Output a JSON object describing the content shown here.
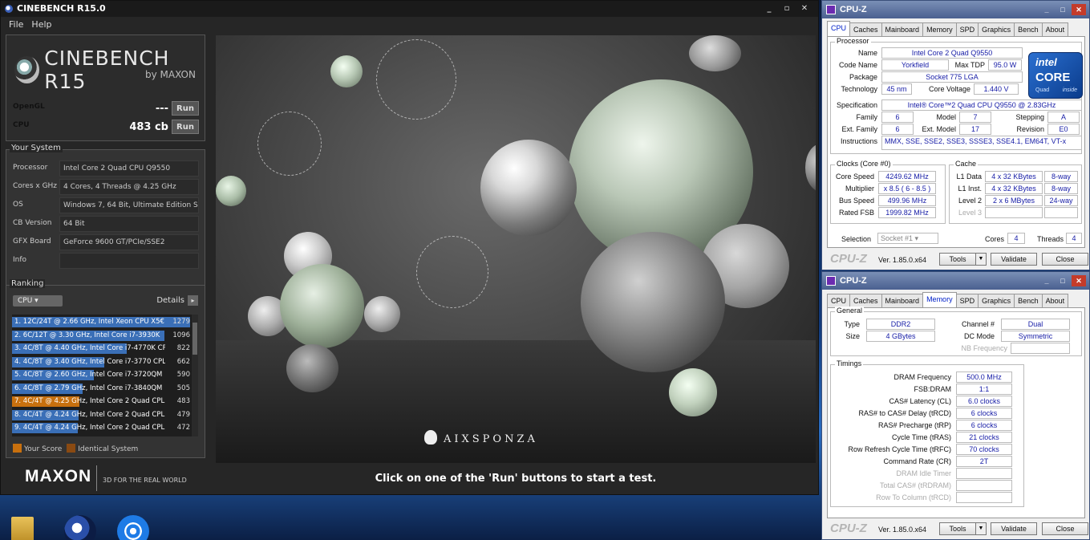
{
  "cinebench": {
    "title": "CINEBENCH R15.0",
    "menu": [
      "File",
      "Help"
    ],
    "brand": "CINEBENCH R15",
    "brand_sub": "by MAXON",
    "opengl_label": "OpenGL",
    "opengl_value": "---",
    "cpu_label": "CPU",
    "cpu_value": "483 cb",
    "run_label": "Run",
    "your_system_title": "Your System",
    "system": [
      {
        "key": "Processor",
        "value": "Intel Core 2 Quad CPU Q9550"
      },
      {
        "key": "Cores x GHz",
        "value": "4 Cores, 4 Threads @ 4.25 GHz"
      },
      {
        "key": "OS",
        "value": "Windows 7, 64 Bit, Ultimate Edition Ser"
      },
      {
        "key": "CB Version",
        "value": "64 Bit"
      },
      {
        "key": "GFX Board",
        "value": "GeForce 9600 GT/PCIe/SSE2"
      },
      {
        "key": "Info",
        "value": ""
      }
    ],
    "ranking_title": "Ranking",
    "ranking_select": "CPU",
    "details_label": "Details",
    "ranking_max": 1279,
    "ranking": [
      {
        "text": "1. 12C/24T @ 2.66 GHz, Intel Xeon CPU X5€",
        "score": "1279",
        "value": 1279,
        "color": "#3a6fb7"
      },
      {
        "text": "2. 6C/12T @ 3.30 GHz,  Intel Core i7-3930K",
        "score": "1096",
        "value": 1096,
        "color": "#3a6fb7"
      },
      {
        "text": "3. 4C/8T @ 4.40 GHz, Intel Core i7-4770K CP",
        "score": "822",
        "value": 822,
        "color": "#3a6fb7"
      },
      {
        "text": "4. 4C/8T @ 3.40 GHz,  Intel Core i7-3770 CPL",
        "score": "662",
        "value": 662,
        "color": "#3a6fb7"
      },
      {
        "text": "5. 4C/8T @ 2.60 GHz, Intel Core i7-3720QM",
        "score": "590",
        "value": 590,
        "color": "#3a6fb7"
      },
      {
        "text": "6. 4C/8T @ 2.79 GHz,  Intel Core i7-3840QM",
        "score": "505",
        "value": 505,
        "color": "#3a6fb7"
      },
      {
        "text": "7. 4C/4T @ 4.25 GHz, Intel Core 2 Quad CPL",
        "score": "483",
        "value": 483,
        "color": "#c8700e"
      },
      {
        "text": "8. 4C/4T @ 4.24 GHz, Intel Core 2 Quad CPL",
        "score": "479",
        "value": 479,
        "color": "#3a6fb7"
      },
      {
        "text": "9. 4C/4T @ 4.24 GHz, Intel Core 2 Quad CPL",
        "score": "472",
        "value": 472,
        "color": "#3a6fb7"
      }
    ],
    "legend_your_score": "Your Score",
    "legend_identical": "Identical System",
    "legend_your_color": "#c8700e",
    "legend_identical_color": "#8a4a12",
    "maxon_logo": "MAXON",
    "maxon_tag": "3D FOR THE REAL WORLD",
    "render_brand": "AIXSPONZA",
    "status": "Click on one of the 'Run' buttons to start a test."
  },
  "cpuz_cpu": {
    "title": "CPU-Z",
    "tabs": [
      "CPU",
      "Caches",
      "Mainboard",
      "Memory",
      "SPD",
      "Graphics",
      "Bench",
      "About"
    ],
    "processor_title": "Processor",
    "name_label": "Name",
    "name": "Intel Core 2 Quad Q9550",
    "codename_label": "Code Name",
    "codename": "Yorkfield",
    "maxtdp_label": "Max TDP",
    "maxtdp": "95.0 W",
    "package_label": "Package",
    "package": "Socket 775 LGA",
    "technology_label": "Technology",
    "technology": "45 nm",
    "corevoltage_label": "Core Voltage",
    "corevoltage": "1.440 V",
    "spec_label": "Specification",
    "spec": "Intel® Core™2 Quad CPU    Q9550  @ 2.83GHz",
    "family_label": "Family",
    "family": "6",
    "model_label": "Model",
    "model": "7",
    "stepping_label": "Stepping",
    "stepping": "A",
    "extfamily_label": "Ext. Family",
    "extfamily": "6",
    "extmodel_label": "Ext. Model",
    "extmodel": "17",
    "revision_label": "Revision",
    "revision": "E0",
    "instructions_label": "Instructions",
    "instructions": "MMX, SSE, SSE2, SSE3, SSSE3, SSE4.1, EM64T, VT-x",
    "clocks_title": "Clocks (Core #0)",
    "corespeed_label": "Core Speed",
    "corespeed": "4249.62 MHz",
    "multiplier_label": "Multiplier",
    "multiplier": "x 8.5 ( 6 - 8.5 )",
    "busspeed_label": "Bus Speed",
    "busspeed": "499.96 MHz",
    "ratedfsb_label": "Rated FSB",
    "ratedfsb": "1999.82 MHz",
    "cache_title": "Cache",
    "l1data_label": "L1 Data",
    "l1data": "4 x 32 KBytes",
    "l1data_way": "8-way",
    "l1inst_label": "L1 Inst.",
    "l1inst": "4 x 32 KBytes",
    "l1inst_way": "8-way",
    "level2_label": "Level 2",
    "level2": "2 x 6 MBytes",
    "level2_way": "24-way",
    "level3_label": "Level 3",
    "selection_label": "Selection",
    "selection": "Socket #1",
    "cores_label": "Cores",
    "cores": "4",
    "threads_label": "Threads",
    "threads": "4",
    "intel_brand": "intel",
    "intel_core": "CORE",
    "intel_quad": "Quad",
    "intel_inside": "inside",
    "logo": "CPU-Z",
    "version": "Ver. 1.85.0.x64",
    "tools": "Tools",
    "validate": "Validate",
    "close": "Close"
  },
  "cpuz_mem": {
    "title": "CPU-Z",
    "tabs": [
      "CPU",
      "Caches",
      "Mainboard",
      "Memory",
      "SPD",
      "Graphics",
      "Bench",
      "About"
    ],
    "general_title": "General",
    "type_label": "Type",
    "type": "DDR2",
    "channel_label": "Channel #",
    "channel": "Dual",
    "size_label": "Size",
    "size": "4 GBytes",
    "dcmode_label": "DC Mode",
    "dcmode": "Symmetric",
    "nbfreq_label": "NB Frequency",
    "timings_title": "Timings",
    "timings": [
      {
        "label": "DRAM Frequency",
        "value": "500.0 MHz",
        "dim": false
      },
      {
        "label": "FSB:DRAM",
        "value": "1:1",
        "dim": false
      },
      {
        "label": "CAS# Latency (CL)",
        "value": "6.0 clocks",
        "dim": false
      },
      {
        "label": "RAS# to CAS# Delay (tRCD)",
        "value": "6 clocks",
        "dim": false
      },
      {
        "label": "RAS# Precharge (tRP)",
        "value": "6 clocks",
        "dim": false
      },
      {
        "label": "Cycle Time (tRAS)",
        "value": "21 clocks",
        "dim": false
      },
      {
        "label": "Row Refresh Cycle Time (tRFC)",
        "value": "70 clocks",
        "dim": false
      },
      {
        "label": "Command Rate (CR)",
        "value": "2T",
        "dim": false
      },
      {
        "label": "DRAM Idle Timer",
        "value": "",
        "dim": true
      },
      {
        "label": "Total CAS# (tRDRAM)",
        "value": "",
        "dim": true
      },
      {
        "label": "Row To Column (tRCD)",
        "value": "",
        "dim": true
      }
    ],
    "logo": "CPU-Z",
    "version": "Ver. 1.85.0.x64",
    "tools": "Tools",
    "validate": "Validate",
    "close": "Close"
  }
}
